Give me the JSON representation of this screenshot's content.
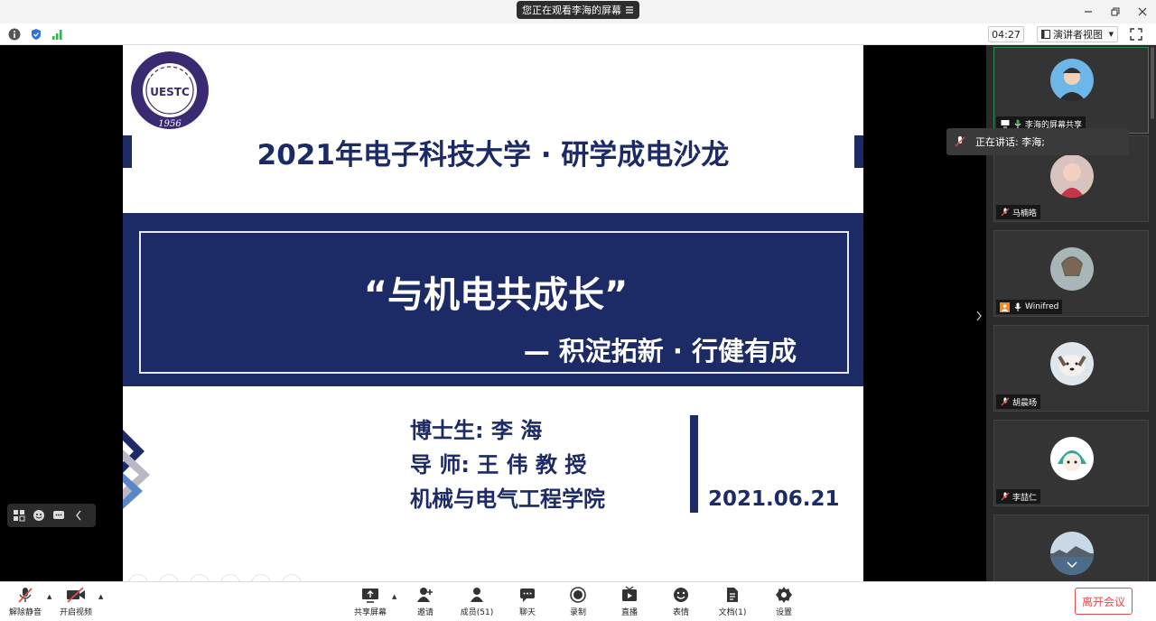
{
  "titlebar": {
    "sharing_notice": "您正在观看李海的屏幕"
  },
  "infobar": {
    "timer": "04:27",
    "view_mode": "演讲者视图"
  },
  "slide": {
    "logo_text": "UESTC",
    "logo_year": "1956",
    "title": "2021年电子科技大学 · 研学成电沙龙",
    "quote_title": "“与机电共成长”",
    "motto": "— 积淀拓新 · 行健有成",
    "lines": [
      "博士生: 李  海",
      "导  师: 王  伟   教 授",
      "机械与电气工程学院"
    ],
    "date": "2021.06.21"
  },
  "speaking_toast": "正在讲话: 李海;",
  "participants": [
    {
      "name": "李海的屏幕共享",
      "active": true
    },
    {
      "name": "马楠皓",
      "active": false
    },
    {
      "name": "Winifred",
      "active": false
    },
    {
      "name": "胡晨旸",
      "active": false
    },
    {
      "name": "李喆仁",
      "active": false
    },
    {
      "name": "",
      "active": false
    }
  ],
  "toolbar": {
    "unmute": "解除静音",
    "start_video": "开启视频",
    "share_screen": "共享屏幕",
    "invite": "邀请",
    "members": "成员(51)",
    "chat": "聊天",
    "record": "录制",
    "live": "直播",
    "reactions": "表情",
    "docs": "文档(1)",
    "settings": "设置",
    "leave": "离开会议"
  },
  "colors": {
    "slide_navy": "#1c2a66",
    "active_border": "#2e8b4f",
    "leave_red": "#e24b4b"
  }
}
